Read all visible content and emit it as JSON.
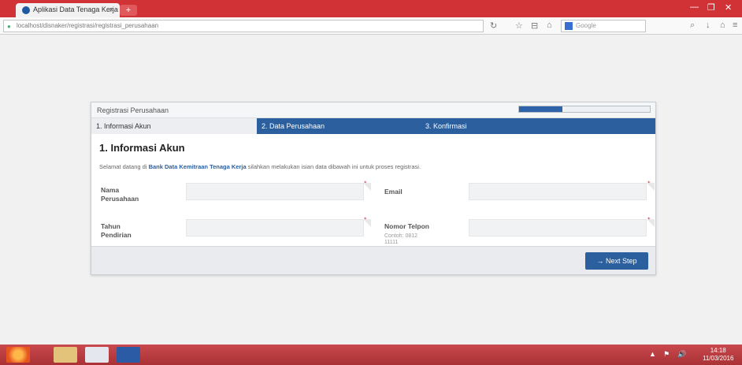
{
  "browser": {
    "tab_title": "Aplikasi Data Tenaga Kerja",
    "tab_close": "×",
    "newtab": "+",
    "url": "localhost/disnaker/registrasi/registrasi_perusahaan",
    "search_placeholder": "Google",
    "window_controls": [
      "—",
      "❐",
      "✕"
    ]
  },
  "form": {
    "panel_title": "Registrasi Perusahaan",
    "progress": 0.33,
    "steps": [
      {
        "label": "1. Informasi Akun",
        "active": true
      },
      {
        "label": "2. Data Perusahaan",
        "active": false
      },
      {
        "label": "3. Konfirmasi",
        "active": false
      }
    ],
    "section_title": "1. Informasi Akun",
    "intro_prefix": "Selamat datang di",
    "intro_highlight": "Bank Data Kemitraan Tenaga Kerja",
    "intro_suffix": "silahkan melakukan isian data dibawah ini untuk proses registrasi.",
    "fields": {
      "company_name_label": "Nama Perusahaan",
      "email_label": "Email",
      "founded_year_label": "Tahun Pendirian",
      "phone_label": "Nomor Telpon",
      "phone_hint": "Contoh: 0812 11111"
    },
    "required_mark": "*",
    "next_button": "→ Next Step"
  },
  "taskbar": {
    "tray_icons": [
      "▲",
      "⚑",
      "🔊"
    ],
    "clock_time": "14:18",
    "clock_date": "11/03/2016"
  },
  "colors": {
    "titlebar": "#d13236",
    "step_bar": "#2b5f9e",
    "button": "#2b5f9e"
  }
}
